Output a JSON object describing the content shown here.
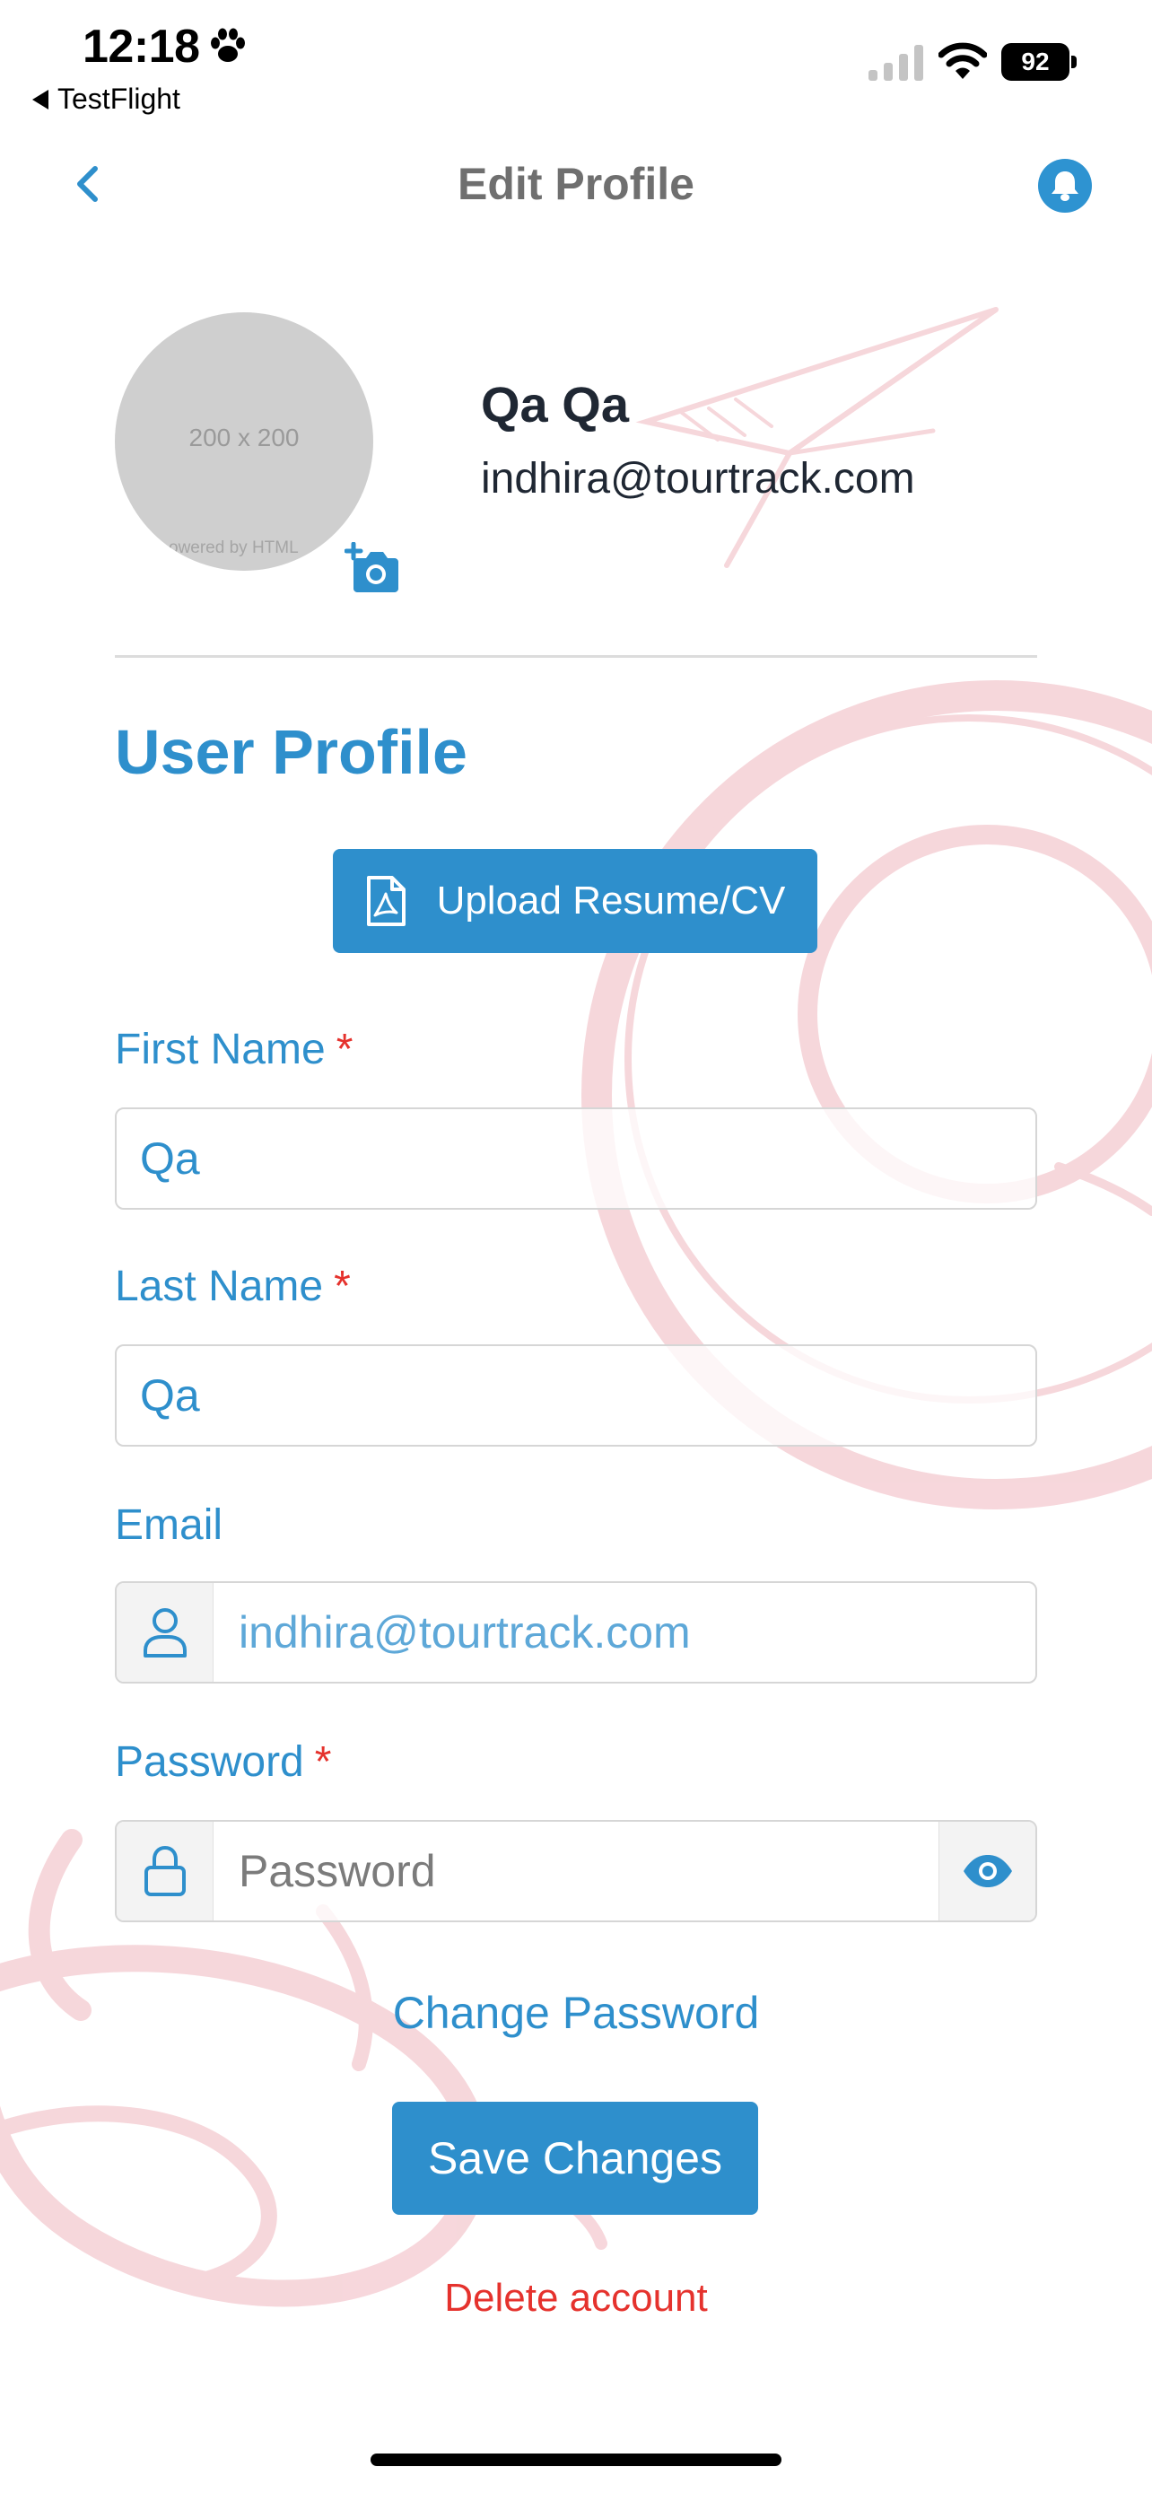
{
  "status_bar": {
    "time": "12:18",
    "back_app": "TestFlight",
    "battery": "92",
    "icons": [
      "paw-icon",
      "signal-icon",
      "wifi-icon",
      "battery-icon"
    ]
  },
  "nav": {
    "title": "Edit Profile",
    "back_icon": "chevron-left-icon",
    "bell_icon": "bell-icon"
  },
  "profile": {
    "avatar_placeholder": "200 x 200",
    "avatar_caption": "owered by HTML",
    "name": "Qa Qa",
    "email": "indhira@tourtrack.com",
    "camera_icon": "camera-add-icon"
  },
  "form": {
    "section_title": "User Profile",
    "upload_label": "Upload Resume/CV",
    "first_name": {
      "label": "First Name",
      "required_mark": "*",
      "value": "Qa"
    },
    "last_name": {
      "label": "Last Name",
      "required_mark": "*",
      "value": "Qa"
    },
    "email": {
      "label": "Email",
      "value": "indhira@tourtrack.com"
    },
    "password": {
      "label": "Password",
      "required_mark": "*",
      "placeholder": "Password"
    },
    "change_password": "Change Password",
    "save_label": "Save Changes",
    "delete_label": "Delete account"
  },
  "colors": {
    "accent": "#2e8fcc",
    "danger": "#e5322d",
    "decor": "#f4c9cf"
  }
}
